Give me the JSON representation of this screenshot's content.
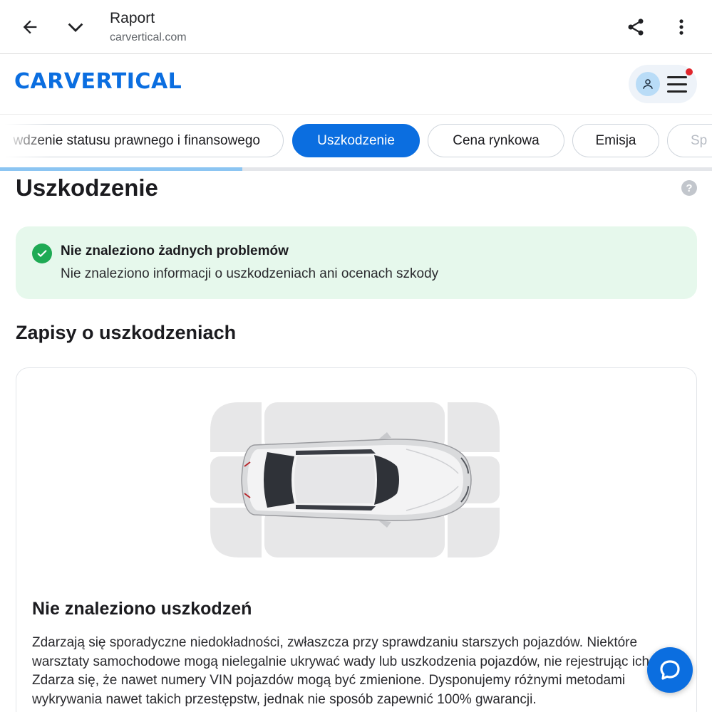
{
  "browser": {
    "title": "Raport",
    "url": "carvertical.com",
    "icons": [
      "back-arrow-icon",
      "chevron-down-icon",
      "share-icon",
      "more-vert-icon"
    ]
  },
  "header": {
    "logo_text": "CARVERTICAL",
    "brand_color": "#0b6ee0",
    "has_notification": true
  },
  "tabs": [
    {
      "label": "wdzenie statusu prawnego i finansowego",
      "active": false
    },
    {
      "label": "Uszkodzenie",
      "active": true
    },
    {
      "label": "Cena rynkowa",
      "active": false
    },
    {
      "label": "Emisja",
      "active": false
    },
    {
      "label": "Sp",
      "active": false
    }
  ],
  "scroll_progress": 0.34,
  "section": {
    "title": "Uszkodzenie",
    "help": "?"
  },
  "alert": {
    "title": "Nie znaleziono żadnych problemów",
    "text": "Nie znaleziono informacji o uszkodzeniach ani ocenach szkody",
    "color": "#e6f8ec"
  },
  "records": {
    "title": "Zapisy o uszkodzeniach",
    "card_title": "Nie znaleziono uszkodzeń",
    "card_text": "Zdarzają się sporadyczne niedokładności, zwłaszcza przy sprawdzaniu starszych pojazdów. Niektóre warsztaty samochodowe mogą nielegalnie ukrywać wady lub uszkodzenia pojazdów, nie rejestrując ich. Zdarza się, że nawet numery VIN pojazdów mogą być zmienione. Dysponujemy różnymi metodami wykrywania nawet takich przestępstw, jednak nie sposób zapewnić 100% gwarancji."
  }
}
